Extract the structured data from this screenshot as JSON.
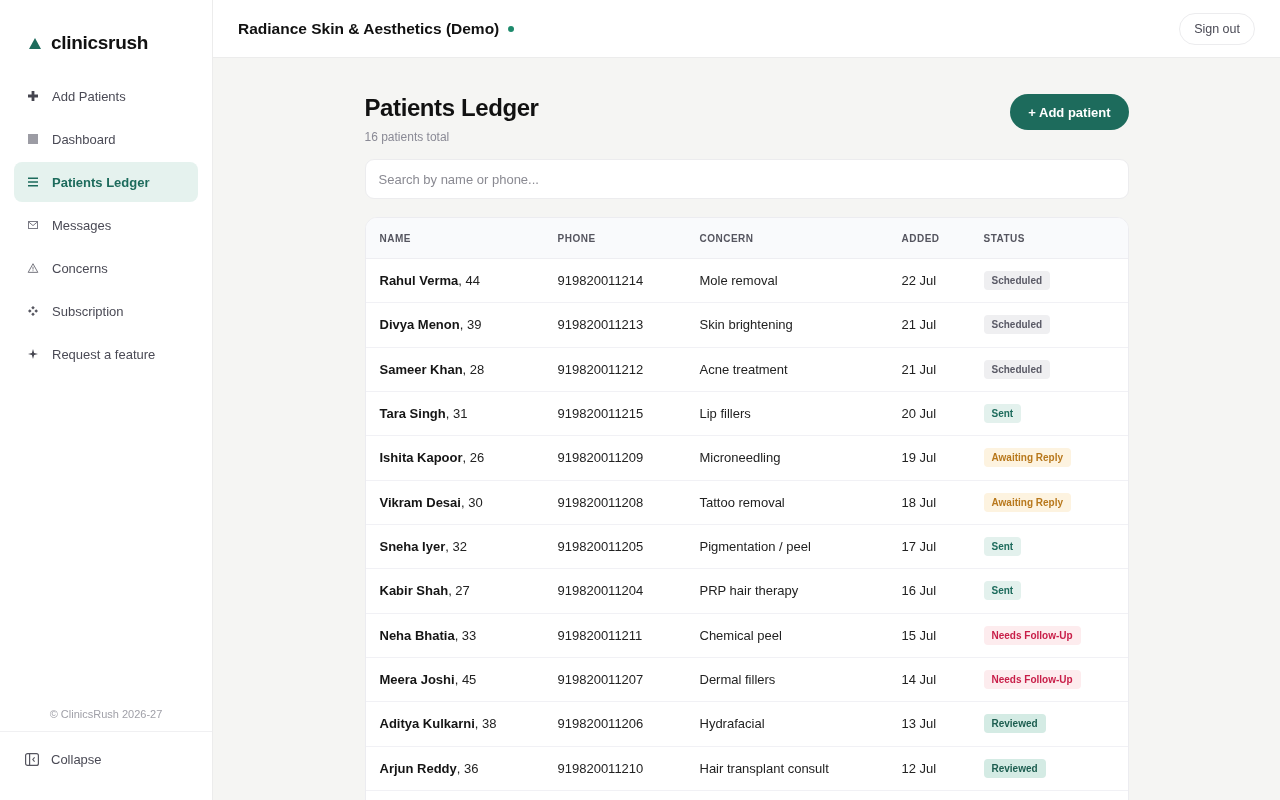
{
  "sidebar": {
    "logo": "clinicsrush",
    "items": [
      {
        "label": "Add Patients",
        "selected": false
      },
      {
        "label": "Dashboard",
        "selected": false
      },
      {
        "label": "Patients Ledger",
        "selected": true
      },
      {
        "label": "Messages",
        "selected": false
      },
      {
        "label": "Concerns",
        "selected": false
      },
      {
        "label": "Subscription",
        "selected": false
      },
      {
        "label": "Request a feature",
        "selected": false
      }
    ],
    "copyright": "© ClinicsRush 2026-27",
    "collapse": "Collapse"
  },
  "header": {
    "title": "Radiance Skin & Aesthetics (Demo)",
    "sign_out": "Sign out"
  },
  "page": {
    "title": "Patients Ledger",
    "subtitle": "16 patients total",
    "add_button": "+ Add patient"
  },
  "search": {
    "placeholder": "Search by name or phone..."
  },
  "table": {
    "columns": [
      "NAME",
      "PHONE",
      "CONCERN",
      "ADDED",
      "STATUS"
    ],
    "rows": [
      {
        "name": "**Rahul Verma**, 44",
        "phone": "919820011214",
        "concern": "Mole removal",
        "added": "22 Jul",
        "status": {
          "label": "Scheduled",
          "kind": "scheduled"
        }
      },
      {
        "name": "**Divya Menon**, 39",
        "phone": "919820011213",
        "concern": "Skin brightening",
        "added": "21 Jul",
        "status": {
          "label": "Scheduled",
          "kind": "scheduled"
        }
      },
      {
        "name": "**Sameer Khan**, 28",
        "phone": "919820011212",
        "concern": "Acne treatment",
        "added": "21 Jul",
        "status": {
          "label": "Scheduled",
          "kind": "scheduled"
        }
      },
      {
        "name": "**Tara Singh**, 31",
        "phone": "919820011215",
        "concern": "Lip fillers",
        "added": "20 Jul",
        "status": {
          "label": "Sent",
          "kind": "sent"
        }
      },
      {
        "name": "**Ishita Kapoor**, 26",
        "phone": "919820011209",
        "concern": "Microneedling",
        "added": "19 Jul",
        "status": {
          "label": "Awaiting Reply",
          "kind": "awaiting"
        }
      },
      {
        "name": "**Vikram Desai**, 30",
        "phone": "919820011208",
        "concern": "Tattoo removal",
        "added": "18 Jul",
        "status": {
          "label": "Awaiting Reply",
          "kind": "awaiting"
        }
      },
      {
        "name": "**Sneha Iyer**, 32",
        "phone": "919820011205",
        "concern": "Pigmentation / peel",
        "added": "17 Jul",
        "status": {
          "label": "Sent",
          "kind": "sent"
        }
      },
      {
        "name": "**Kabir Shah**, 27",
        "phone": "919820011204",
        "concern": "PRP hair therapy",
        "added": "16 Jul",
        "status": {
          "label": "Sent",
          "kind": "sent"
        }
      },
      {
        "name": "**Neha Bhatia**, 33",
        "phone": "919820011211",
        "concern": "Chemical peel",
        "added": "15 Jul",
        "status": {
          "label": "Needs Follow-Up",
          "kind": "followup"
        }
      },
      {
        "name": "**Meera Joshi**, 45",
        "phone": "919820011207",
        "concern": "Dermal fillers",
        "added": "14 Jul",
        "status": {
          "label": "Needs Follow-Up",
          "kind": "followup"
        }
      },
      {
        "name": "**Aditya Kulkarni**, 38",
        "phone": "919820011206",
        "concern": "Hydrafacial",
        "added": "13 Jul",
        "status": {
          "label": "Reviewed",
          "kind": "reviewed"
        }
      },
      {
        "name": "**Arjun Reddy**, 36",
        "phone": "919820011210",
        "concern": "Hair transplant consult",
        "added": "12 Jul",
        "status": {
          "label": "Reviewed",
          "kind": "reviewed"
        }
      }
    ]
  }
}
